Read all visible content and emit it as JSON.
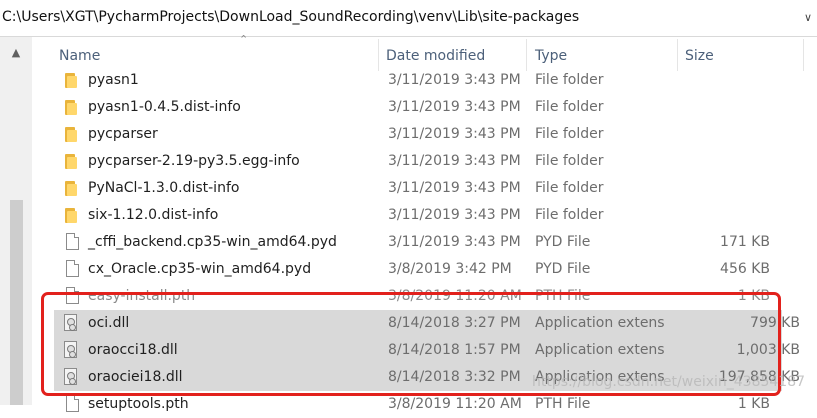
{
  "address": {
    "path": "C:\\Users\\XGT\\PycharmProjects\\DownLoad_SoundRecording\\venv\\Lib\\site-packages",
    "dropdown_icon": "chevron-down-icon"
  },
  "columns": [
    {
      "label": "Name"
    },
    {
      "label": "Date modified"
    },
    {
      "label": "Type"
    },
    {
      "label": "Size"
    }
  ],
  "rows": [
    {
      "name": "pyasn1",
      "date": "3/11/2019 3:43 PM",
      "type": "File folder",
      "size": "",
      "icon": "folder-icon"
    },
    {
      "name": "pyasn1-0.4.5.dist-info",
      "date": "3/11/2019 3:43 PM",
      "type": "File folder",
      "size": "",
      "icon": "folder-icon"
    },
    {
      "name": "pycparser",
      "date": "3/11/2019 3:43 PM",
      "type": "File folder",
      "size": "",
      "icon": "folder-icon"
    },
    {
      "name": "pycparser-2.19-py3.5.egg-info",
      "date": "3/11/2019 3:43 PM",
      "type": "File folder",
      "size": "",
      "icon": "folder-icon"
    },
    {
      "name": "PyNaCl-1.3.0.dist-info",
      "date": "3/11/2019 3:43 PM",
      "type": "File folder",
      "size": "",
      "icon": "folder-icon"
    },
    {
      "name": "six-1.12.0.dist-info",
      "date": "3/11/2019 3:43 PM",
      "type": "File folder",
      "size": "",
      "icon": "folder-icon"
    },
    {
      "name": "_cffi_backend.cp35-win_amd64.pyd",
      "date": "3/11/2019 3:43 PM",
      "type": "PYD File",
      "size": "171 KB",
      "icon": "file-icon"
    },
    {
      "name": "cx_Oracle.cp35-win_amd64.pyd",
      "date": "3/8/2019 3:42 PM",
      "type": "PYD File",
      "size": "456 KB",
      "icon": "file-icon"
    },
    {
      "name": "easy-install.pth",
      "date": "3/8/2019 11:20 AM",
      "type": "PTH File",
      "size": "1 KB",
      "icon": "file-icon"
    },
    {
      "name": "oci.dll",
      "date": "8/14/2018 3:27 PM",
      "type": "Application extens",
      "size": "799 KB",
      "icon": "dll-icon"
    },
    {
      "name": "oraocci18.dll",
      "date": "8/14/2018 1:57 PM",
      "type": "Application extens",
      "size": "1,003 KB",
      "icon": "dll-icon"
    },
    {
      "name": "oraociei18.dll",
      "date": "8/14/2018 3:32 PM",
      "type": "Application extens",
      "size": "197,858 KB",
      "icon": "dll-icon"
    },
    {
      "name": "setuptools.pth",
      "date": "3/8/2019 11:20 AM",
      "type": "PTH File",
      "size": "1 KB",
      "icon": "file-icon"
    }
  ],
  "watermark": "https://blog.csdn.net/weixin_43854187"
}
